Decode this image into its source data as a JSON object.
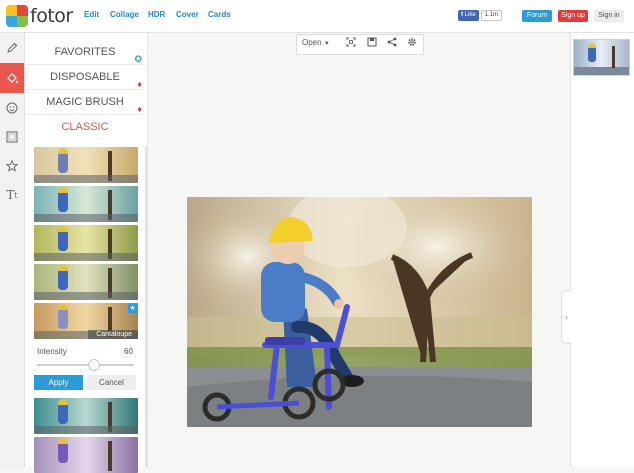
{
  "app": {
    "logo_text": "fotor",
    "nav": [
      "Edit",
      "Collage",
      "HDR",
      "Cover",
      "Cards"
    ],
    "like_label": "Like",
    "like_count": "1.1m",
    "forum_label": "Forum",
    "signup_label": "Sign up",
    "signin_label": "Sign in"
  },
  "rail_icons": [
    "pencil-icon",
    "paint-bucket-icon",
    "face-icon",
    "frame-icon",
    "sticker-icon",
    "text-icon"
  ],
  "panel": {
    "categories": [
      {
        "label": "FAVORITES",
        "icon": "star-badge-icon"
      },
      {
        "label": "DISPOSABLE",
        "icon": "diamond-icon"
      },
      {
        "label": "MAGIC BRUSH",
        "icon": "diamond-icon"
      },
      {
        "label": "CLASSIC",
        "icon": ""
      }
    ],
    "selected_filter_name": "Cantaloupe",
    "intensity_label": "Intensity",
    "intensity_value": "60",
    "intensity_fraction": 0.6,
    "apply_label": "Apply",
    "cancel_label": "Cancel"
  },
  "toolbar": {
    "open_label": "Open",
    "icons": [
      "dropdown-caret-icon",
      "fit-screen-icon",
      "save-icon",
      "share-icon",
      "settings-icon"
    ]
  },
  "colors": {
    "accent_blue": "#2b9cd8",
    "nav_blue": "#1e88cf",
    "signup_red": "#e33b3b",
    "classic_red": "#e0554d",
    "active_rail": "#e8584e"
  }
}
